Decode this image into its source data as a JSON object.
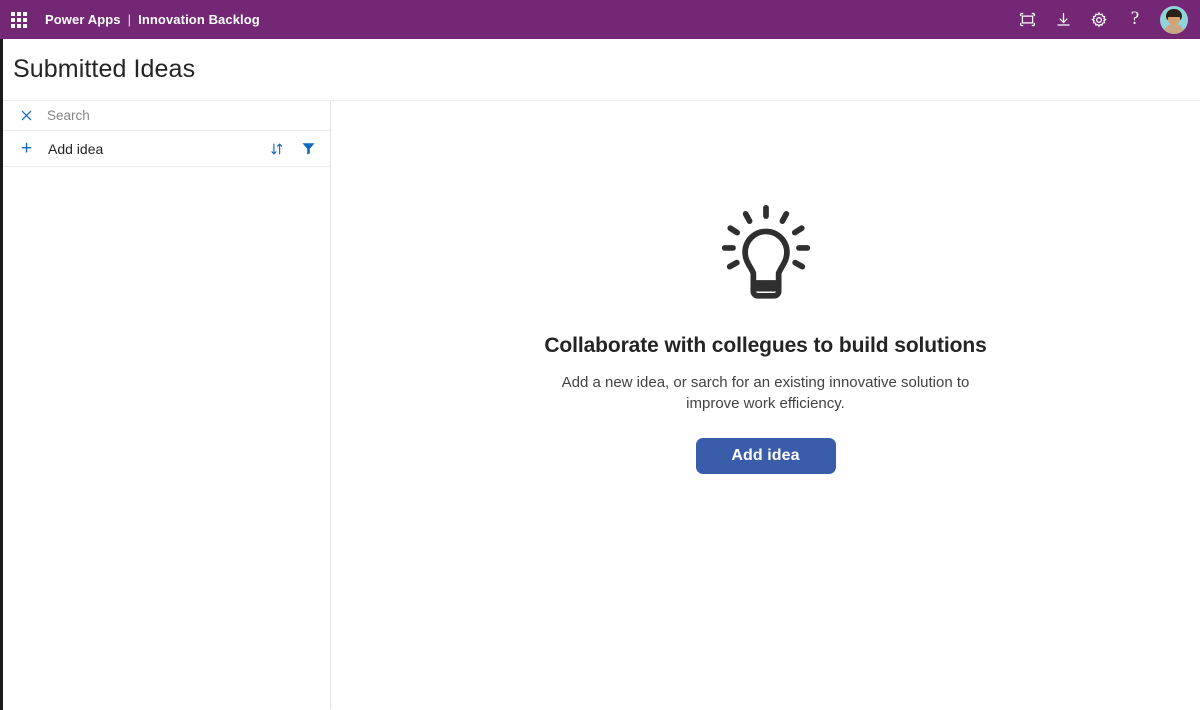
{
  "topbar": {
    "waffle_label": "app-launcher",
    "brand": "Power Apps",
    "divider": "|",
    "app_name": "Innovation Backlog",
    "icons": [
      {
        "name": "screen-frame-icon",
        "label": "Open in new frame"
      },
      {
        "name": "download-icon",
        "label": "Download"
      },
      {
        "name": "gear-icon",
        "label": "Settings"
      },
      {
        "name": "help-icon",
        "label": "?"
      }
    ],
    "avatar_label": "Account manager",
    "background_color": "#742774"
  },
  "page": {
    "title": "Submitted Ideas"
  },
  "sidebar": {
    "search": {
      "clear_icon": "close-icon",
      "value": "",
      "placeholder": "Search"
    },
    "add_row": {
      "plus_icon": "plus-icon",
      "label": "Add idea",
      "sort_icon": "sort-icon",
      "filter_icon": "filter-icon"
    },
    "items": []
  },
  "main": {
    "illustration": "lightbulb-icon",
    "title": "Collaborate with collegues to build solutions",
    "subtitle": "Add a new idea, or sarch for an existing innovative solution to improve work efficiency.",
    "button_label": "Add idea",
    "button_color": "#3a5dab"
  }
}
